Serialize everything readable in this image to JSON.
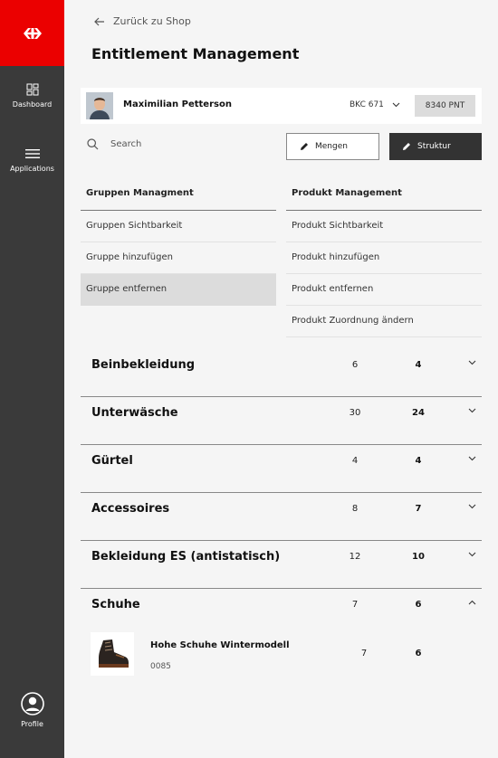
{
  "sidebar": {
    "dashboard_label": "Dashboard",
    "applications_label": "Applications",
    "profile_label": "Profile",
    "brand_color": "#eb0000",
    "bg_color": "#3a3a3a"
  },
  "header": {
    "back_label": "Zurück zu Shop",
    "title": "Entitlement Management"
  },
  "user": {
    "name": "Maximilian Petterson",
    "department": "BKC 671",
    "points": "8340 PNT"
  },
  "toolbar": {
    "search_placeholder": "Search",
    "mengen_label": "Mengen",
    "struktur_label": "Struktur"
  },
  "menus": {
    "gruppen": {
      "heading": "Gruppen Managment",
      "items": [
        "Gruppen Sichtbarkeit",
        "Gruppe hinzufügen",
        "Gruppe entfernen"
      ],
      "active_index": 2
    },
    "produkt": {
      "heading": "Produkt Management",
      "items": [
        "Produkt Sichtbarkeit",
        "Produkt hinzufügen",
        "Produkt entfernen",
        "Produkt Zuordnung ändern"
      ]
    }
  },
  "categories": [
    {
      "name": "Beinbekleidung",
      "count": "6",
      "selected": "4",
      "expanded": false
    },
    {
      "name": "Unterwäsche",
      "count": "30",
      "selected": "24",
      "expanded": false
    },
    {
      "name": "Gürtel",
      "count": "4",
      "selected": "4",
      "expanded": false
    },
    {
      "name": "Accessoires",
      "count": "8",
      "selected": "7",
      "expanded": false
    },
    {
      "name": "Bekleidung ES (antistatisch)",
      "count": "12",
      "selected": "10",
      "expanded": false
    },
    {
      "name": "Schuhe",
      "count": "7",
      "selected": "6",
      "expanded": true
    }
  ],
  "product": {
    "name": "Hohe Schuhe Wintermodell",
    "code": "0085",
    "count": "7",
    "selected": "6"
  }
}
